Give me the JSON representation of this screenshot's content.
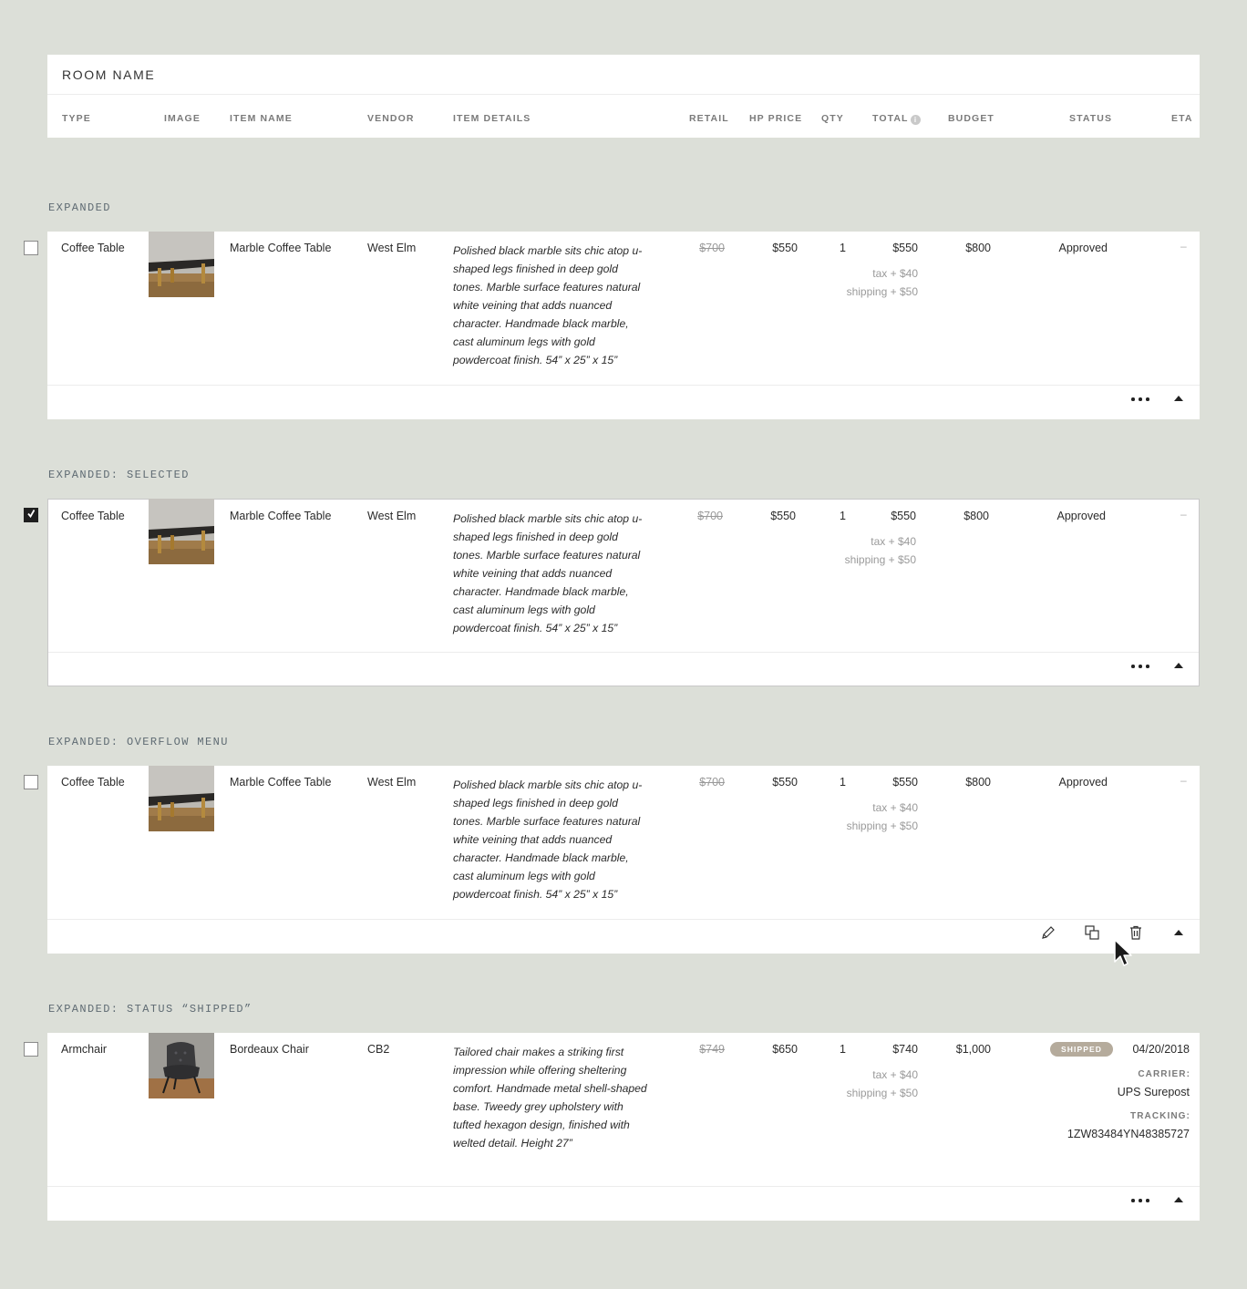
{
  "header": {
    "room_name": "ROOM NAME",
    "columns": {
      "type": "TYPE",
      "image": "IMAGE",
      "item_name": "ITEM NAME",
      "vendor": "VENDOR",
      "item_details": "ITEM DETAILS",
      "retail": "RETAIL",
      "hp_price": "HP PRICE",
      "qty": "QTY",
      "total": "TOTAL",
      "budget": "BUDGET",
      "status": "STATUS",
      "eta": "ETA"
    }
  },
  "sections": [
    {
      "label": "EXPANDED",
      "checked": false,
      "footer": "more",
      "row": {
        "type": "Coffee Table",
        "image": "marble-coffee-table",
        "item_name": "Marble Coffee Table",
        "vendor": "West Elm",
        "details": "Polished black marble sits chic atop u-shaped legs finished in deep gold tones. Marble surface features natural white veining that adds nuanced character. Handmade black marble, cast aluminum legs with gold powdercoat finish. 54” x 25” x 15”",
        "retail": "$700",
        "hp_price": "$550",
        "qty": "1",
        "total": "$550",
        "tax_label": "tax",
        "tax_value": "+ $40",
        "shipping_label": "shipping",
        "shipping_value": "+ $50",
        "budget": "$800",
        "status": "Approved",
        "eta": "–"
      }
    },
    {
      "label": "EXPANDED: SELECTED",
      "checked": true,
      "footer": "more",
      "row": {
        "type": "Coffee Table",
        "image": "marble-coffee-table",
        "item_name": "Marble Coffee Table",
        "vendor": "West Elm",
        "details": "Polished black marble sits chic atop u-shaped legs finished in deep gold tones. Marble surface features natural white veining that adds nuanced character. Handmade black marble, cast aluminum legs with gold powdercoat finish. 54” x 25” x 15”",
        "retail": "$700",
        "hp_price": "$550",
        "qty": "1",
        "total": "$550",
        "tax_label": "tax",
        "tax_value": "+ $40",
        "shipping_label": "shipping",
        "shipping_value": "+ $50",
        "budget": "$800",
        "status": "Approved",
        "eta": "–"
      }
    },
    {
      "label": "EXPANDED: OVERFLOW MENU",
      "checked": false,
      "footer": "overflow",
      "row": {
        "type": "Coffee Table",
        "image": "marble-coffee-table",
        "item_name": "Marble Coffee Table",
        "vendor": "West Elm",
        "details": "Polished black marble sits chic atop u-shaped legs finished in deep gold tones. Marble surface features natural white veining that adds nuanced character. Handmade black marble, cast aluminum legs with gold powdercoat finish. 54” x 25” x 15”",
        "retail": "$700",
        "hp_price": "$550",
        "qty": "1",
        "total": "$550",
        "tax_label": "tax",
        "tax_value": "+ $40",
        "shipping_label": "shipping",
        "shipping_value": "+ $50",
        "budget": "$800",
        "status": "Approved",
        "eta": "–"
      }
    },
    {
      "label": "EXPANDED: STATUS “SHIPPED”",
      "checked": false,
      "footer": "more",
      "row": {
        "type": "Armchair",
        "image": "bordeaux-chair",
        "item_name": "Bordeaux Chair",
        "vendor": "CB2",
        "details": "Tailored chair makes a striking first impression while offering sheltering comfort. Handmade metal shell-shaped base. Tweedy grey upholstery with tufted hexagon design, finished with welted detail. Height 27”",
        "retail": "$749",
        "hp_price": "$650",
        "qty": "1",
        "total": "$740",
        "tax_label": "tax",
        "tax_value": "+ $40",
        "shipping_label": "shipping",
        "shipping_value": "+ $50",
        "budget": "$1,000",
        "status_badge": "SHIPPED",
        "eta": "04/20/2018",
        "carrier_label": "CARRIER:",
        "carrier": "UPS Surepost",
        "tracking_label": "TRACKING:",
        "tracking": "1ZW83484YN48385727"
      }
    }
  ],
  "icons": [
    "check-icon",
    "more-icon",
    "collapse-up-icon",
    "edit-pencil-icon",
    "duplicate-icon",
    "trash-icon",
    "mouse-cursor-icon",
    "info-icon"
  ],
  "colors": {
    "background": "#dcdfd8",
    "card": "#ffffff",
    "section_label": "#5f6b73",
    "shipped_badge": "#b5ab9c",
    "muted_text": "#9a9a9a"
  }
}
